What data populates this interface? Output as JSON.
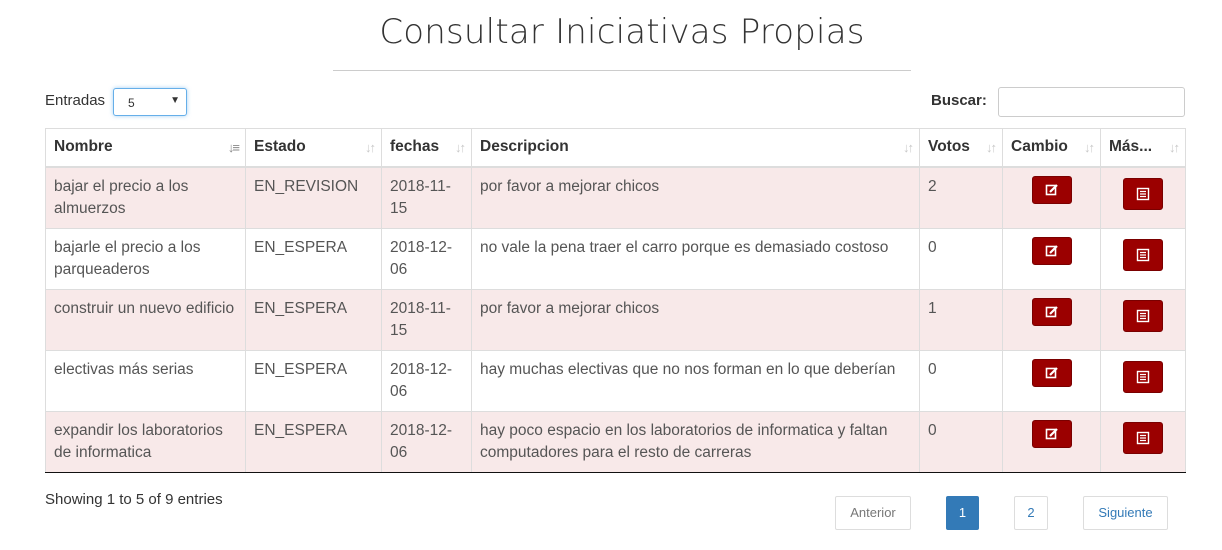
{
  "page": {
    "title": "Consultar Iniciativas Propias"
  },
  "length": {
    "label": "Entradas",
    "value": "5"
  },
  "search": {
    "label": "Buscar:",
    "placeholder": "",
    "value": ""
  },
  "table": {
    "headers": [
      "Nombre",
      "Estado",
      "fechas",
      "Descripcion",
      "Votos",
      "Cambio",
      "Más..."
    ],
    "rows": [
      {
        "nombre": "bajar el precio a los almuerzos",
        "estado": "EN_REVISION",
        "fecha": "2018-11-15",
        "descripcion": "por favor a mejorar chicos",
        "votos": "2"
      },
      {
        "nombre": "bajarle el precio a los parqueaderos",
        "estado": "EN_ESPERA",
        "fecha": "2018-12-06",
        "descripcion": "no vale la pena traer el carro porque es demasiado costoso",
        "votos": "0"
      },
      {
        "nombre": "construir un nuevo edificio",
        "estado": "EN_ESPERA",
        "fecha": "2018-11-15",
        "descripcion": "por favor a mejorar chicos",
        "votos": "1"
      },
      {
        "nombre": "electivas más serias",
        "estado": "EN_ESPERA",
        "fecha": "2018-12-06",
        "descripcion": "hay muchas electivas que no nos forman en lo que deberían",
        "votos": "0"
      },
      {
        "nombre": "expandir los laboratorios de informatica",
        "estado": "EN_ESPERA",
        "fecha": "2018-12-06",
        "descripcion": "hay poco espacio en los laboratorios de informatica y faltan computadores para el resto de carreras",
        "votos": "0"
      }
    ]
  },
  "info": "Showing 1 to 5 of 9 entries",
  "pagination": {
    "previous": "Anterior",
    "pages": [
      "1",
      "2"
    ],
    "next": "Siguiente",
    "current": "1"
  },
  "colors": {
    "accent_button": "#9b0000",
    "stripe": "#f8e9e9",
    "active_page": "#337ab7"
  },
  "icons": {
    "sort": "sort-icon",
    "edit": "edit-icon",
    "details": "list-icon"
  }
}
